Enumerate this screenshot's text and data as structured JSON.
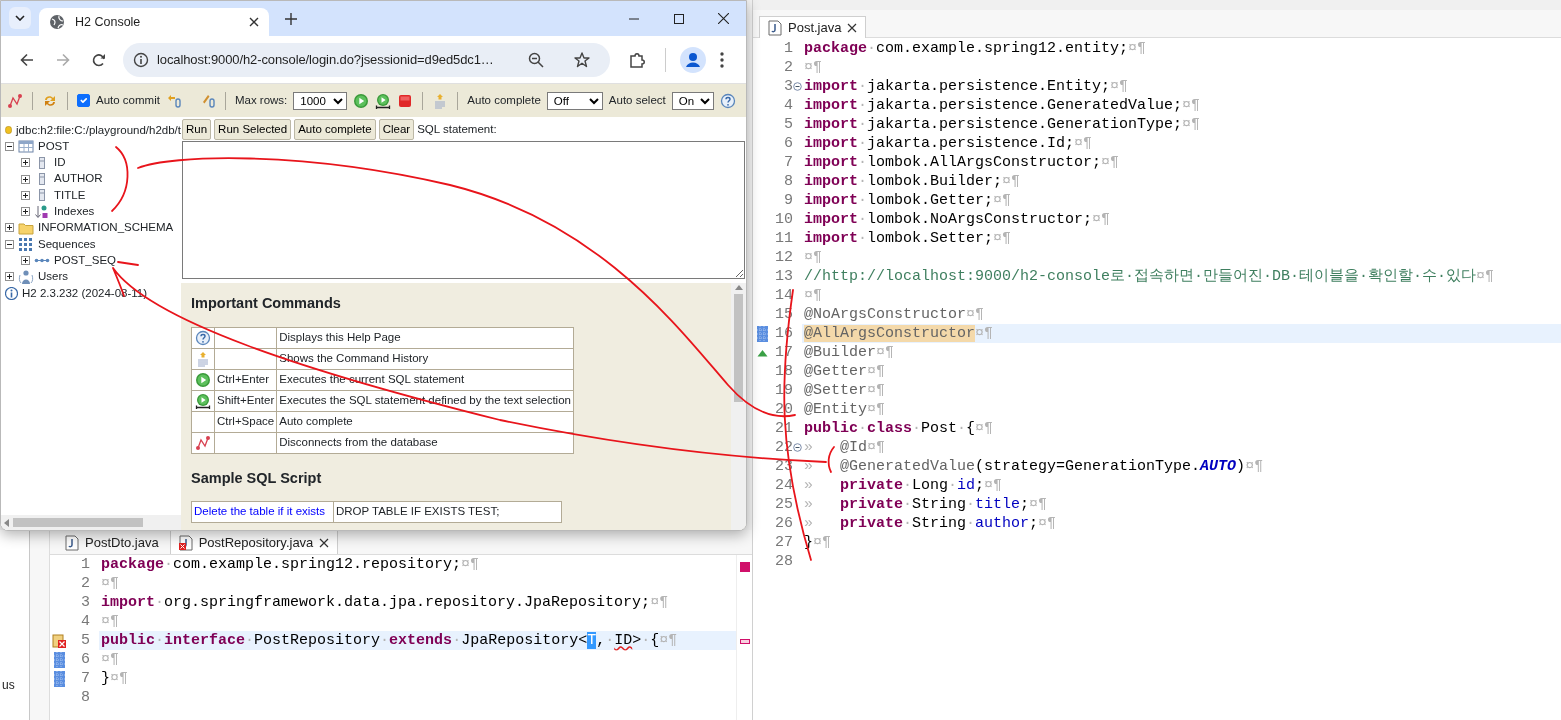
{
  "browser": {
    "tab_title": "H2 Console",
    "url": "localhost:9000/h2-console/login.do?jsessionid=d9ed5dc1…"
  },
  "h2": {
    "toolbar": {
      "auto_commit": {
        "label": "Auto commit",
        "checked": true
      },
      "max_rows": {
        "label": "Max rows:",
        "value": "1000"
      },
      "auto_complete": {
        "label": "Auto complete",
        "value": "Off"
      },
      "auto_select": {
        "label": "Auto select",
        "value": "On"
      }
    },
    "connection": "jdbc:h2:file:C:/playground/h2db/t",
    "tree": [
      {
        "label": "POST",
        "kind": "table",
        "expanded": true,
        "children": [
          {
            "label": "ID",
            "kind": "column",
            "expanded": false
          },
          {
            "label": "AUTHOR",
            "kind": "column",
            "expanded": false
          },
          {
            "label": "TITLE",
            "kind": "column",
            "expanded": false
          },
          {
            "label": "Indexes",
            "kind": "indexes",
            "expanded": false
          }
        ]
      },
      {
        "label": "INFORMATION_SCHEMA",
        "kind": "folder",
        "expanded": false
      },
      {
        "label": "Sequences",
        "kind": "sequences",
        "expanded": true,
        "children": [
          {
            "label": "POST_SEQ",
            "kind": "sequence",
            "expanded": false
          }
        ]
      },
      {
        "label": "Users",
        "kind": "users",
        "expanded": false
      }
    ],
    "version": "H2 2.3.232 (2024-08-11)",
    "buttons": [
      "Run",
      "Run Selected",
      "Auto complete",
      "Clear"
    ],
    "sql_label": "SQL statement:",
    "help": {
      "title": "Important Commands",
      "commands": [
        {
          "kind": "help",
          "description": "Displays this Help Page"
        },
        {
          "kind": "history",
          "description": "Shows the Command History"
        },
        {
          "kind": "run",
          "shortcut": "Ctrl+Enter",
          "description": "Executes the current SQL statement"
        },
        {
          "kind": "run-selected",
          "shortcut": "Shift+Enter",
          "description": "Executes the SQL statement defined by the text selection"
        },
        {
          "shortcut": "Ctrl+Space",
          "description": "Auto complete"
        },
        {
          "kind": "disconnect",
          "description": "Disconnects from the database"
        }
      ]
    },
    "sample": {
      "title": "Sample SQL Script",
      "rows": [
        {
          "link": "Delete the table if it exists",
          "sql": "DROP TABLE IF EXISTS TEST;"
        }
      ]
    }
  },
  "editor_right": {
    "tabs": [
      {
        "label": "Post.java",
        "selected": true,
        "error": false
      }
    ],
    "lines": [
      {
        "n": "1",
        "current": false,
        "tokens": [
          {
            "kind": "kw",
            "text": "package"
          },
          {
            "kind": "ws",
            "text": "·"
          },
          {
            "kind": "p",
            "text": "com.example.spring12.entity;"
          },
          {
            "kind": "ws",
            "text": "¤¶"
          }
        ]
      },
      {
        "n": "2",
        "current": false,
        "tokens": [
          {
            "kind": "ws",
            "text": "¤¶"
          }
        ]
      },
      {
        "n": "3",
        "current": false,
        "kind": "fold",
        "tokens": [
          {
            "kind": "kw",
            "text": "import"
          },
          {
            "kind": "ws",
            "text": "·"
          },
          {
            "kind": "p",
            "text": "jakarta.persistence.Entity;"
          },
          {
            "kind": "ws",
            "text": "¤¶"
          }
        ]
      },
      {
        "n": "4",
        "current": false,
        "tokens": [
          {
            "kind": "kw",
            "text": "import"
          },
          {
            "kind": "ws",
            "text": "·"
          },
          {
            "kind": "p",
            "text": "jakarta.persistence.GeneratedValue;"
          },
          {
            "kind": "ws",
            "text": "¤¶"
          }
        ]
      },
      {
        "n": "5",
        "current": false,
        "tokens": [
          {
            "kind": "kw",
            "text": "import"
          },
          {
            "kind": "ws",
            "text": "·"
          },
          {
            "kind": "p",
            "text": "jakarta.persistence.GenerationType;"
          },
          {
            "kind": "ws",
            "text": "¤¶"
          }
        ]
      },
      {
        "n": "6",
        "current": false,
        "tokens": [
          {
            "kind": "kw",
            "text": "import"
          },
          {
            "kind": "ws",
            "text": "·"
          },
          {
            "kind": "p",
            "text": "jakarta.persistence.Id;"
          },
          {
            "kind": "ws",
            "text": "¤¶"
          }
        ]
      },
      {
        "n": "7",
        "current": false,
        "tokens": [
          {
            "kind": "kw",
            "text": "import"
          },
          {
            "kind": "ws",
            "text": "·"
          },
          {
            "kind": "p",
            "text": "lombok.AllArgsConstructor;"
          },
          {
            "kind": "ws",
            "text": "¤¶"
          }
        ]
      },
      {
        "n": "8",
        "current": false,
        "tokens": [
          {
            "kind": "kw",
            "text": "import"
          },
          {
            "kind": "ws",
            "text": "·"
          },
          {
            "kind": "p",
            "text": "lombok.Builder;"
          },
          {
            "kind": "ws",
            "text": "¤¶"
          }
        ]
      },
      {
        "n": "9",
        "current": false,
        "tokens": [
          {
            "kind": "kw",
            "text": "import"
          },
          {
            "kind": "ws",
            "text": "·"
          },
          {
            "kind": "p",
            "text": "lombok.Getter;"
          },
          {
            "kind": "ws",
            "text": "¤¶"
          }
        ]
      },
      {
        "n": "10",
        "current": false,
        "tokens": [
          {
            "kind": "kw",
            "text": "import"
          },
          {
            "kind": "ws",
            "text": "·"
          },
          {
            "kind": "p",
            "text": "lombok.NoArgsConstructor;"
          },
          {
            "kind": "ws",
            "text": "¤¶"
          }
        ]
      },
      {
        "n": "11",
        "current": false,
        "tokens": [
          {
            "kind": "kw",
            "text": "import"
          },
          {
            "kind": "ws",
            "text": "·"
          },
          {
            "kind": "p",
            "text": "lombok.Setter;"
          },
          {
            "kind": "ws",
            "text": "¤¶"
          }
        ]
      },
      {
        "n": "12",
        "current": false,
        "tokens": [
          {
            "kind": "ws",
            "text": "¤¶"
          }
        ]
      },
      {
        "n": "13",
        "current": false,
        "tokens": [
          {
            "kind": "comment",
            "text": "//http://localhost:9000/h2-console로·접속하면·만들어진·DB·테이블을·확인할·수·있다"
          },
          {
            "kind": "ws",
            "text": "¤¶"
          }
        ]
      },
      {
        "n": "14",
        "current": false,
        "tokens": [
          {
            "kind": "ws",
            "text": "¤¶"
          }
        ]
      },
      {
        "n": "15",
        "current": false,
        "tokens": [
          {
            "kind": "ann",
            "text": "@NoArgsConstructor"
          },
          {
            "kind": "ws",
            "text": "¤¶"
          }
        ]
      },
      {
        "n": "16",
        "current": true,
        "kind": "change",
        "tokens": [
          {
            "kind": "occ",
            "text": "@AllArgsConstructor"
          },
          {
            "kind": "ws",
            "text": "¤¶"
          }
        ]
      },
      {
        "n": "17",
        "current": false,
        "kind": "override",
        "tokens": [
          {
            "kind": "ann",
            "text": "@Builder"
          },
          {
            "kind": "ws",
            "text": "¤¶"
          }
        ]
      },
      {
        "n": "18",
        "current": false,
        "tokens": [
          {
            "kind": "ann",
            "text": "@Getter"
          },
          {
            "kind": "ws",
            "text": "¤¶"
          }
        ]
      },
      {
        "n": "19",
        "current": false,
        "tokens": [
          {
            "kind": "ann",
            "text": "@Setter"
          },
          {
            "kind": "ws",
            "text": "¤¶"
          }
        ]
      },
      {
        "n": "20",
        "current": false,
        "tokens": [
          {
            "kind": "ann",
            "text": "@Entity"
          },
          {
            "kind": "ws",
            "text": "¤¶"
          }
        ]
      },
      {
        "n": "21",
        "current": false,
        "tokens": [
          {
            "kind": "kw",
            "text": "public"
          },
          {
            "kind": "ws",
            "text": "·"
          },
          {
            "kind": "kw",
            "text": "class"
          },
          {
            "kind": "ws",
            "text": "·"
          },
          {
            "kind": "p",
            "text": "Post"
          },
          {
            "kind": "ws",
            "text": "·"
          },
          {
            "kind": "p",
            "text": "{"
          },
          {
            "kind": "ws",
            "text": "¤¶"
          }
        ]
      },
      {
        "n": "22",
        "current": false,
        "kind": "fold",
        "indent": "»",
        "tokens": [
          {
            "kind": "ann",
            "text": "@Id"
          },
          {
            "kind": "ws",
            "text": "¤¶"
          }
        ]
      },
      {
        "n": "23",
        "current": false,
        "indent": "»",
        "tokens": [
          {
            "kind": "ann",
            "text": "@GeneratedValue"
          },
          {
            "kind": "p",
            "text": "(strategy=GenerationType."
          },
          {
            "kind": "const",
            "text": "AUTO"
          },
          {
            "kind": "p",
            "text": ")"
          },
          {
            "kind": "ws",
            "text": "¤¶"
          }
        ]
      },
      {
        "n": "24",
        "current": false,
        "indent": "»",
        "tokens": [
          {
            "kind": "kw",
            "text": "private"
          },
          {
            "kind": "ws",
            "text": "·"
          },
          {
            "kind": "p",
            "text": "Long"
          },
          {
            "kind": "ws",
            "text": "·"
          },
          {
            "kind": "field",
            "text": "id"
          },
          {
            "kind": "p",
            "text": ";"
          },
          {
            "kind": "ws",
            "text": "¤¶"
          }
        ]
      },
      {
        "n": "25",
        "current": false,
        "indent": "»",
        "tokens": [
          {
            "kind": "kw",
            "text": "private"
          },
          {
            "kind": "ws",
            "text": "·"
          },
          {
            "kind": "p",
            "text": "String"
          },
          {
            "kind": "ws",
            "text": "·"
          },
          {
            "kind": "field",
            "text": "title"
          },
          {
            "kind": "p",
            "text": ";"
          },
          {
            "kind": "ws",
            "text": "¤¶"
          }
        ]
      },
      {
        "n": "26",
        "current": false,
        "indent": "»",
        "tokens": [
          {
            "kind": "kw",
            "text": "private"
          },
          {
            "kind": "ws",
            "text": "·"
          },
          {
            "kind": "p",
            "text": "String"
          },
          {
            "kind": "ws",
            "text": "·"
          },
          {
            "kind": "field",
            "text": "author"
          },
          {
            "kind": "p",
            "text": ";"
          },
          {
            "kind": "ws",
            "text": "¤¶"
          }
        ]
      },
      {
        "n": "27",
        "current": false,
        "tokens": [
          {
            "kind": "p",
            "text": "}"
          },
          {
            "kind": "ws",
            "text": "¤¶"
          }
        ]
      },
      {
        "n": "28",
        "current": false
      }
    ]
  },
  "editor_bottom": {
    "tabs": [
      {
        "label": "PostDto.java",
        "selected": false,
        "error": false
      },
      {
        "label": "PostRepository.java",
        "selected": true,
        "error": true
      }
    ],
    "lines": [
      {
        "n": "1",
        "current": false,
        "tokens": [
          {
            "kind": "kw",
            "text": "package"
          },
          {
            "kind": "ws",
            "text": "·"
          },
          {
            "kind": "p",
            "text": "com.example.spring12.repository;"
          },
          {
            "kind": "ws",
            "text": "¤¶"
          }
        ]
      },
      {
        "n": "2",
        "current": false,
        "tokens": [
          {
            "kind": "ws",
            "text": "¤¶"
          }
        ]
      },
      {
        "n": "3",
        "current": false,
        "tokens": [
          {
            "kind": "kw",
            "text": "import"
          },
          {
            "kind": "ws",
            "text": "·"
          },
          {
            "kind": "p",
            "text": "org.springframework.data.jpa.repository.JpaRepository;"
          },
          {
            "kind": "ws",
            "text": "¤¶"
          }
        ]
      },
      {
        "n": "4",
        "current": false,
        "tokens": [
          {
            "kind": "ws",
            "text": "¤¶"
          }
        ]
      },
      {
        "n": "5",
        "current": true,
        "kind": "error",
        "tokens": [
          {
            "kind": "kw",
            "text": "public"
          },
          {
            "kind": "ws",
            "text": "·"
          },
          {
            "kind": "kw",
            "text": "interface"
          },
          {
            "kind": "ws",
            "text": "·"
          },
          {
            "kind": "p",
            "text": "PostRepository"
          },
          {
            "kind": "ws",
            "text": "·"
          },
          {
            "kind": "kw",
            "text": "extends"
          },
          {
            "kind": "ws",
            "text": "·"
          },
          {
            "kind": "p",
            "text": "JpaRepository<"
          },
          {
            "kind": "sel",
            "text": "T"
          },
          {
            "kind": "p",
            "text": ","
          },
          {
            "kind": "ws",
            "text": "·"
          },
          {
            "kind": "err",
            "text": "ID"
          },
          {
            "kind": "p",
            "text": ">"
          },
          {
            "kind": "ws",
            "text": "·"
          },
          {
            "kind": "p",
            "text": "{"
          },
          {
            "kind": "ws",
            "text": "¤¶"
          }
        ]
      },
      {
        "n": "6",
        "current": false,
        "kind": "change",
        "tokens": [
          {
            "kind": "ws",
            "text": "¤¶"
          }
        ]
      },
      {
        "n": "7",
        "current": false,
        "kind": "change",
        "tokens": [
          {
            "kind": "p",
            "text": "}"
          },
          {
            "kind": "ws",
            "text": "¤¶"
          }
        ]
      },
      {
        "n": "8",
        "current": false
      }
    ]
  },
  "side_text": "us"
}
